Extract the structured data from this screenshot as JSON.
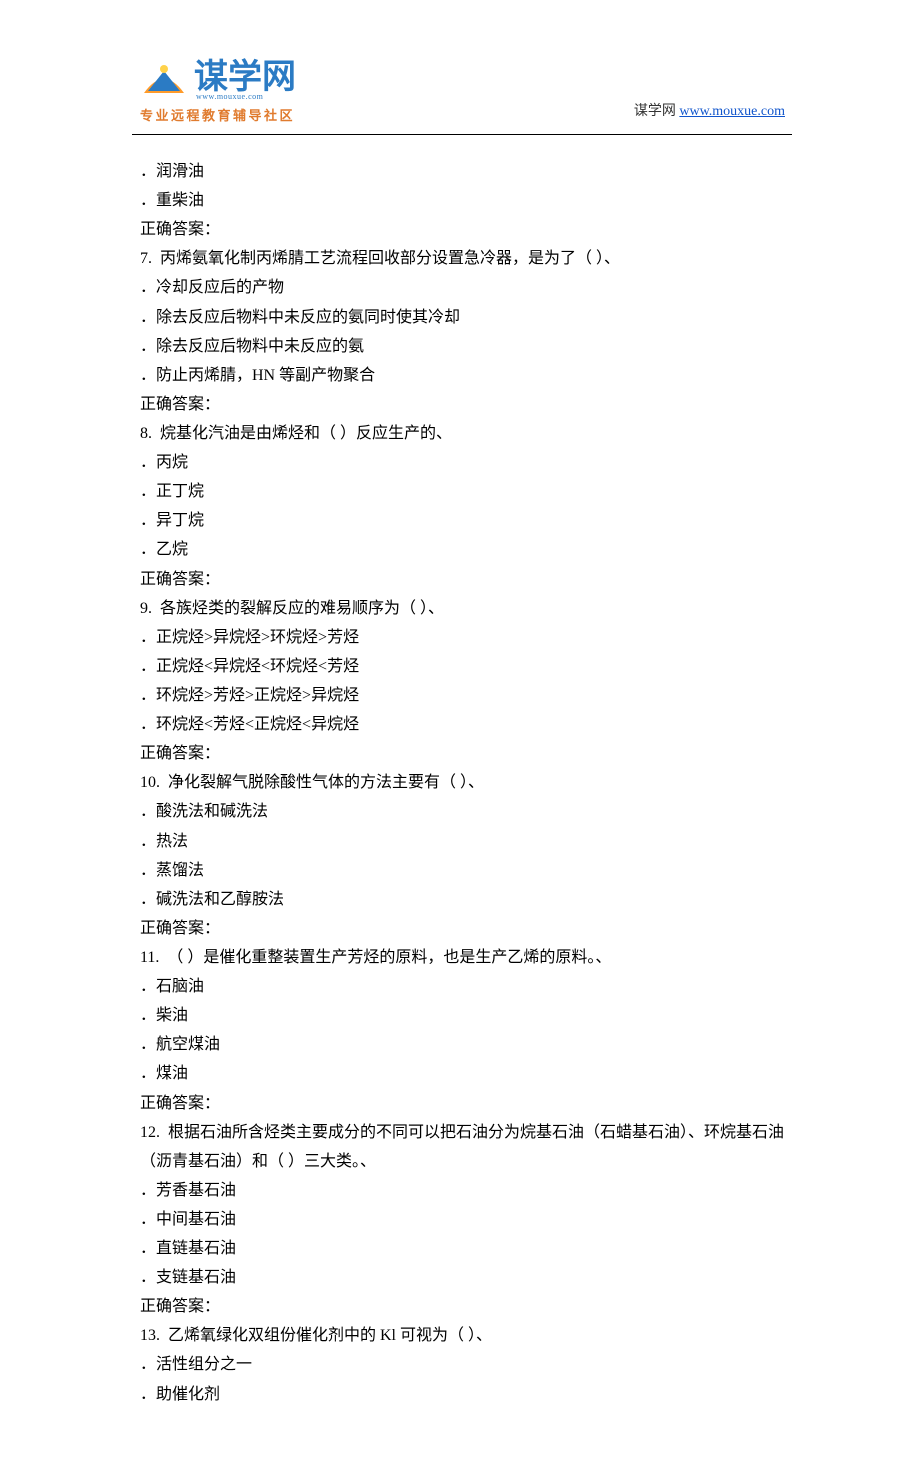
{
  "header": {
    "logo_main": "谋学网",
    "logo_tagline": "专业远程教育辅导社区",
    "logo_sub_small": "www.mouxue.com",
    "site_label": "谋学网",
    "site_url_text": "www.mouxue.com",
    "site_url_href": "http://www.mouxue.com"
  },
  "lines": [
    {
      "cls": "opt",
      "text": "．润滑油"
    },
    {
      "cls": "opt",
      "text": "．重柴油"
    },
    {
      "cls": "ql",
      "text": "正确答案："
    },
    {
      "cls": "ql",
      "text": "7.  丙烯氨氧化制丙烯腈工艺流程回收部分设置急冷器，是为了（ ）、"
    },
    {
      "cls": "opt",
      "text": "．冷却反应后的产物"
    },
    {
      "cls": "opt",
      "text": "．除去反应后物料中未反应的氨同时使其冷却"
    },
    {
      "cls": "opt",
      "text": "．除去反应后物料中未反应的氨"
    },
    {
      "cls": "opt",
      "text": "．防止丙烯腈，HN 等副产物聚合"
    },
    {
      "cls": "ql",
      "text": "正确答案："
    },
    {
      "cls": "ql",
      "text": "8.  烷基化汽油是由烯烃和（ ）反应生产的、"
    },
    {
      "cls": "opt",
      "text": "．丙烷"
    },
    {
      "cls": "opt",
      "text": "．正丁烷"
    },
    {
      "cls": "opt",
      "text": "．异丁烷"
    },
    {
      "cls": "opt",
      "text": "．乙烷"
    },
    {
      "cls": "ql",
      "text": "正确答案："
    },
    {
      "cls": "ql",
      "text": "9.  各族烃类的裂解反应的难易顺序为（ ）、"
    },
    {
      "cls": "opt",
      "text": "．正烷烃>异烷烃>环烷烃>芳烃"
    },
    {
      "cls": "opt",
      "text": "．正烷烃<异烷烃<环烷烃<芳烃"
    },
    {
      "cls": "opt",
      "text": "．环烷烃>芳烃>正烷烃>异烷烃"
    },
    {
      "cls": "opt",
      "text": "．环烷烃<芳烃<正烷烃<异烷烃"
    },
    {
      "cls": "ql",
      "text": "正确答案："
    },
    {
      "cls": "ql",
      "text": "10.  净化裂解气脱除酸性气体的方法主要有（ ）、"
    },
    {
      "cls": "opt",
      "text": "．酸洗法和碱洗法"
    },
    {
      "cls": "opt",
      "text": "．热法"
    },
    {
      "cls": "opt",
      "text": "．蒸馏法"
    },
    {
      "cls": "opt",
      "text": "．碱洗法和乙醇胺法"
    },
    {
      "cls": "ql",
      "text": "正确答案："
    },
    {
      "cls": "ql",
      "text": "11.  （ ）是催化重整装置生产芳烃的原料，也是生产乙烯的原料。、"
    },
    {
      "cls": "opt",
      "text": "．石脑油"
    },
    {
      "cls": "opt",
      "text": "．柴油"
    },
    {
      "cls": "opt",
      "text": "．航空煤油"
    },
    {
      "cls": "opt",
      "text": "．煤油"
    },
    {
      "cls": "ql",
      "text": "正确答案："
    },
    {
      "cls": "ql",
      "text": "12.  根据石油所含烃类主要成分的不同可以把石油分为烷基石油（石蜡基石油）、环烷基石油（沥青基石油）和（ ）三大类。、"
    },
    {
      "cls": "opt",
      "text": "．芳香基石油"
    },
    {
      "cls": "opt",
      "text": "．中间基石油"
    },
    {
      "cls": "opt",
      "text": "．直链基石油"
    },
    {
      "cls": "opt",
      "text": "．支链基石油"
    },
    {
      "cls": "ql",
      "text": "正确答案："
    },
    {
      "cls": "ql",
      "text": "13.  乙烯氧绿化双组份催化剂中的 Kl 可视为（ ）、"
    },
    {
      "cls": "opt",
      "text": "．活性组分之一"
    },
    {
      "cls": "opt",
      "text": "．助催化剂"
    }
  ]
}
